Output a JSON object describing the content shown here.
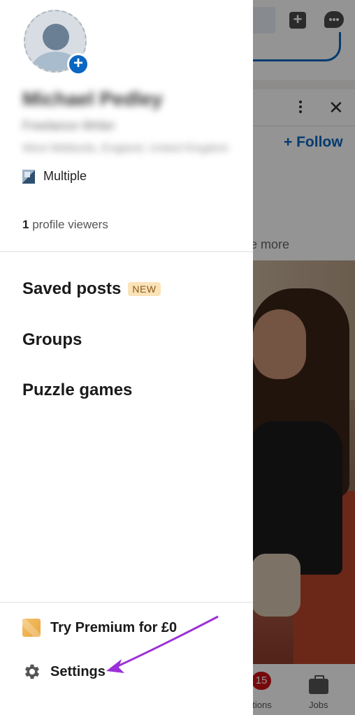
{
  "background": {
    "follow_label": "+ Follow",
    "see_more_label": "e more",
    "notifications_count": "15",
    "tabs": [
      {
        "label": "ations"
      },
      {
        "label": "Jobs"
      }
    ]
  },
  "drawer": {
    "profile": {
      "name": "Michael Pedley",
      "headline": "Freelance Writer",
      "location": "West Midlands, England, United Kingdom"
    },
    "company_label": "Multiple",
    "viewers_count": "1",
    "viewers_label": " profile viewers",
    "menu": [
      {
        "label": "Saved posts",
        "badge": "NEW"
      },
      {
        "label": "Groups"
      },
      {
        "label": "Puzzle games"
      }
    ],
    "bottom": {
      "premium_label": "Try Premium for £0",
      "settings_label": "Settings"
    }
  },
  "colors": {
    "accent": "#0a66c2",
    "arrow": "#9b30d9",
    "badge_new_bg": "#fbe3b8"
  }
}
